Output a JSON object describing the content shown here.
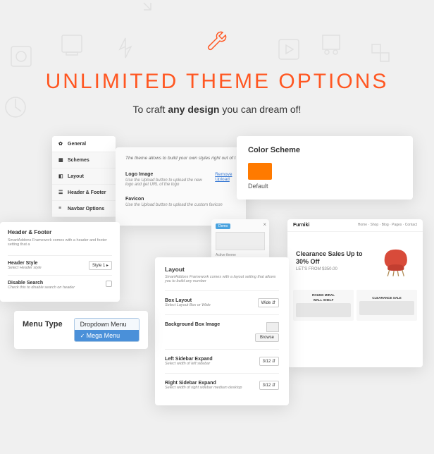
{
  "header": {
    "title": "UNLIMITED THEME OPTIONS",
    "subtitle_pre": "To craft ",
    "subtitle_bold": "any design",
    "subtitle_post": " you can dream of!"
  },
  "nav": {
    "items": [
      {
        "label": "General"
      },
      {
        "label": "Schemes"
      },
      {
        "label": "Layout"
      },
      {
        "label": "Header & Footer"
      },
      {
        "label": "Navbar Options"
      }
    ]
  },
  "general": {
    "hint": "The theme allows to build your own styles right out of t",
    "logo": {
      "label": "Logo Image",
      "desc": "Use the Upload button to upload the new logo and get URL of the logo",
      "link": "Remove Upload"
    },
    "favicon": {
      "label": "Favicon",
      "desc": "Use the Upload button to upload the custom favicon"
    }
  },
  "color_scheme": {
    "title": "Color Scheme",
    "default_label": "Default",
    "swatch": "#ff7a00"
  },
  "header_footer": {
    "title": "Header & Footer",
    "desc": "SmartAddons Framework comes with a header and footer setting that a",
    "style": {
      "label": "Header Style",
      "desc": "Select Header style",
      "value": "Style 1"
    },
    "disable": {
      "label": "Disable Search",
      "desc": "Check this to disable search on header"
    }
  },
  "menu_type": {
    "label": "Menu Type",
    "options": [
      "Dropdown Menu",
      "Mega Menu"
    ],
    "selected": "Mega Menu"
  },
  "theme_sel": {
    "badge": "Demo",
    "caption": "Active theme"
  },
  "layout": {
    "title": "Layout",
    "desc": "SmartAddons Framework comes with a layout setting that allows you to build any number",
    "box": {
      "label": "Box Layout",
      "desc": "Select Layout Box or Wide",
      "value": "Wide"
    },
    "bg": {
      "label": "Background Box Image",
      "browse": "Browse"
    },
    "left": {
      "label": "Left Sidebar Expand",
      "desc": "Select width of left sidebar",
      "value": "3/12"
    },
    "right": {
      "label": "Right Sidebar Expand",
      "desc": "Select width of right sidebar medium desktop",
      "value": "3/12"
    }
  },
  "preview": {
    "brand": "Furniki",
    "nav_items": [
      "Home",
      "Shop",
      "Blog",
      "Pages",
      "Contact"
    ],
    "hero_title": "Clearance Sales Up to 30% Off",
    "hero_sub": "LET'S FROM $350.00",
    "cards": [
      {
        "t1": "ROUND MIRAL",
        "t2": "WALL SHELF"
      },
      {
        "t1": "CLEARANCE SALE",
        "t2": ""
      }
    ]
  }
}
